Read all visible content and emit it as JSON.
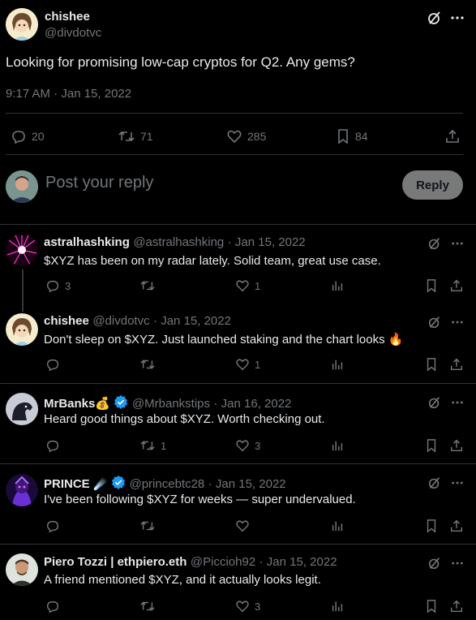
{
  "main_tweet": {
    "author_name": "chishee",
    "author_handle": "@divdotvc",
    "text": "Looking for promising low-cap cryptos for Q2. Any gems?",
    "timestamp": "9:17 AM · Jan 15, 2022",
    "stats": {
      "replies": "20",
      "retweets": "71",
      "likes": "285",
      "bookmarks": "84"
    }
  },
  "composer": {
    "placeholder": "Post your reply",
    "reply_label": "Reply"
  },
  "replies": [
    {
      "name": "astralhashking",
      "emoji": "",
      "verified": false,
      "handle": "@astralhashking",
      "date": "Jan 15, 2022",
      "text": "$XYZ has been on my radar lately. Solid team, great use case.",
      "replies": "3",
      "retweets": "",
      "likes": "1"
    },
    {
      "name": "chishee",
      "emoji": "",
      "verified": false,
      "handle": "@divdotvc",
      "date": "Jan 15, 2022",
      "text": "Don't sleep on $XYZ. Just launched staking and the chart looks 🔥",
      "replies": "",
      "retweets": "",
      "likes": "1"
    },
    {
      "name": "MrBanks💰",
      "emoji": "",
      "verified": true,
      "handle": "@Mrbankstips",
      "date": "Jan 16, 2022",
      "text": "Heard good things about $XYZ. Worth checking out.",
      "replies": "",
      "retweets": "1",
      "likes": "3"
    },
    {
      "name": "PRINCE",
      "emoji": "☄️",
      "verified": true,
      "handle": "@princebtc28",
      "date": "Jan 15, 2022",
      "text": "I've been following $XYZ for weeks — super undervalued.",
      "replies": "",
      "retweets": "",
      "likes": ""
    },
    {
      "name": "Piero Tozzi | ethpiero.eth",
      "emoji": "",
      "verified": false,
      "handle": "@Piccioh92",
      "date": "Jan 15, 2022",
      "text": "A friend mentioned $XYZ, and it actually looks legit.",
      "replies": "",
      "retweets": "",
      "likes": "3"
    }
  ],
  "colors": {
    "background": "#000000",
    "text": "#e7e9ea",
    "muted": "#71767b",
    "verified": "#1d9bf0",
    "divider": "#2f3336"
  },
  "icons": [
    "grok-icon",
    "more-icon",
    "reply-icon",
    "retweet-icon",
    "like-icon",
    "bookmark-icon",
    "share-icon",
    "views-icon",
    "verified-icon"
  ]
}
